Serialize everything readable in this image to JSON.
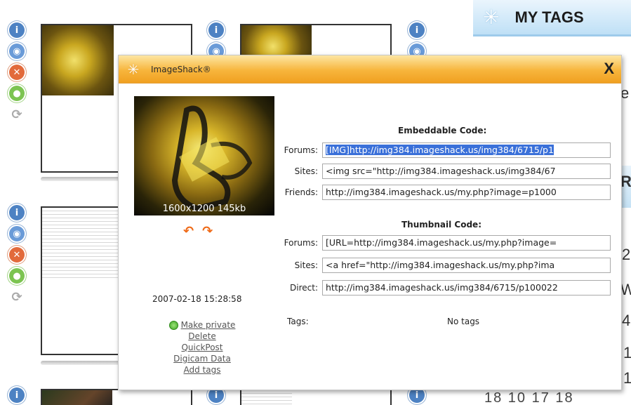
{
  "background": {
    "my_tags_title": "MY TAGS",
    "side_letters": [
      "e",
      "R",
      "2",
      "W",
      "4",
      "1",
      "1"
    ],
    "calendar_row": "18   10   17   18"
  },
  "dialog": {
    "title": "ImageShack®",
    "close_label": "X",
    "image_info": "1600x1200 145kb",
    "rotate_left": "↶",
    "rotate_right": "↷",
    "date": "2007-02-18 15:28:58",
    "actions": {
      "make_private": "Make private",
      "delete": "Delete",
      "quickpost": "QuickPost",
      "digicam": "Digicam Data",
      "add_tags": "Add tags"
    },
    "embeddable": {
      "title": "Embeddable Code:",
      "forums_label": "Forums:",
      "forums_value": "[IMG]http://img384.imageshack.us/img384/6715/p1",
      "sites_label": "Sites:",
      "sites_value": "<img src=\"http://img384.imageshack.us/img384/67",
      "friends_label": "Friends:",
      "friends_value": "http://img384.imageshack.us/my.php?image=p1000"
    },
    "thumbnail": {
      "title": "Thumbnail Code:",
      "forums_label": "Forums:",
      "forums_value": "[URL=http://img384.imageshack.us/my.php?image=",
      "sites_label": "Sites:",
      "sites_value": "<a href=\"http://img384.imageshack.us/my.php?ima",
      "direct_label": "Direct:",
      "direct_value": "http://img384.imageshack.us/img384/6715/p100022"
    },
    "tags_label": "Tags:",
    "tags_value": "No tags"
  }
}
